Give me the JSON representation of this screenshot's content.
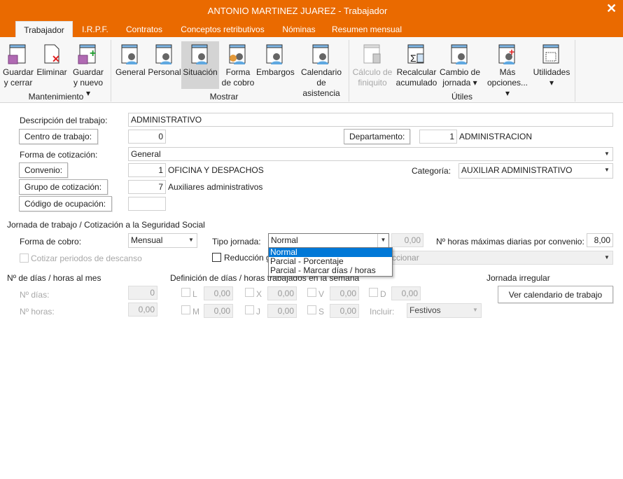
{
  "window": {
    "title": "ANTONIO MARTINEZ JUAREZ - Trabajador",
    "close_icon": "close-icon"
  },
  "tabs": [
    {
      "label": "Trabajador",
      "active": true
    },
    {
      "label": "I.R.P.F."
    },
    {
      "label": "Contratos"
    },
    {
      "label": "Conceptos retributivos"
    },
    {
      "label": "Nóminas"
    },
    {
      "label": "Resumen mensual"
    }
  ],
  "ribbon": {
    "groups": [
      {
        "label": "Mantenimiento"
      },
      {
        "label": "Mostrar"
      },
      {
        "label": "Útiles"
      }
    ],
    "buttons": [
      {
        "l1": "Guardar",
        "l2": "y cerrar",
        "icon": "save-close-icon"
      },
      {
        "l1": "Eliminar",
        "l2": "",
        "icon": "delete-icon"
      },
      {
        "l1": "Guardar",
        "l2": "y nuevo ▾",
        "icon": "save-new-icon"
      },
      {
        "l1": "General",
        "l2": "",
        "icon": "general-icon"
      },
      {
        "l1": "Personal",
        "l2": "",
        "icon": "personal-icon"
      },
      {
        "l1": "Situación",
        "l2": "",
        "icon": "situation-icon",
        "selected": true
      },
      {
        "l1": "Forma",
        "l2": "de cobro",
        "icon": "payment-icon"
      },
      {
        "l1": "Embargos",
        "l2": "",
        "icon": "seizure-icon"
      },
      {
        "l1": "Calendario",
        "l2": "de asistencia",
        "icon": "calendar-icon"
      },
      {
        "l1": "Cálculo de",
        "l2": "finiquito",
        "icon": "settlement-icon",
        "disabled": true
      },
      {
        "l1": "Recalcular",
        "l2": "acumulado",
        "icon": "sum-calculator-icon"
      },
      {
        "l1": "Cambio de",
        "l2": "jornada ▾",
        "icon": "shift-change-icon"
      },
      {
        "l1": "Más",
        "l2": "opciones... ▾",
        "icon": "more-options-icon"
      },
      {
        "l1": "Utilidades",
        "l2": "▾",
        "icon": "calculator-icon"
      }
    ]
  },
  "form": {
    "descripcion_label": "Descripción del trabajo:",
    "descripcion": "ADMINISTRATIVO",
    "centro_btn": "Centro de trabajo:",
    "centro": "0",
    "departamento_btn": "Departamento:",
    "departamento_code": "1",
    "departamento": "ADMINISTRACION",
    "forma_cot_label": "Forma de cotización:",
    "forma_cot": "General",
    "convenio_btn": "Convenio:",
    "convenio_code": "1",
    "convenio": "OFICINA Y DESPACHOS",
    "categoria_label": "Categoría:",
    "categoria": "AUXILIAR ADMINISTRATIVO",
    "grupo_btn": "Grupo de cotización:",
    "grupo_code": "7",
    "grupo": "Auxiliares administrativos",
    "codigo_btn": "Código de ocupación:",
    "codigo": ""
  },
  "jornada": {
    "section": "Jornada de trabajo / Cotización a la Seguridad Social",
    "forma_cobro_label": "Forma de cobro:",
    "forma_cobro": "Mensual",
    "tipo_label": "Tipo jornada:",
    "tipo": "Normal",
    "tipo_pct": "0,00",
    "max_horas_label": "Nº horas máximas diarias por convenio:",
    "max_horas": "8,00",
    "cotizar_label": "Cotizar periodos de descanso",
    "reduccion_label": "Reducción g",
    "reduccion_select": "ccionar",
    "options": [
      "Normal",
      "Parcial - Porcentaje",
      "Parcial - Marcar días / horas"
    ]
  },
  "mes": {
    "section": "Nº de días / horas al mes",
    "dias_label": "Nº días:",
    "dias": "0",
    "horas_label": "Nº horas:",
    "horas": "0,00"
  },
  "semana": {
    "section": "Definición de días / horas trabajados en la semana",
    "days": [
      {
        "d": "L",
        "v": "0,00"
      },
      {
        "d": "X",
        "v": "0,00"
      },
      {
        "d": "V",
        "v": "0,00"
      },
      {
        "d": "D",
        "v": "0,00"
      },
      {
        "d": "M",
        "v": "0,00"
      },
      {
        "d": "J",
        "v": "0,00"
      },
      {
        "d": "S",
        "v": "0,00"
      }
    ],
    "incluir_label": "Incluir:",
    "incluir": "Festivos"
  },
  "irregular": {
    "section": "Jornada irregular",
    "button": "Ver calendario de trabajo"
  }
}
